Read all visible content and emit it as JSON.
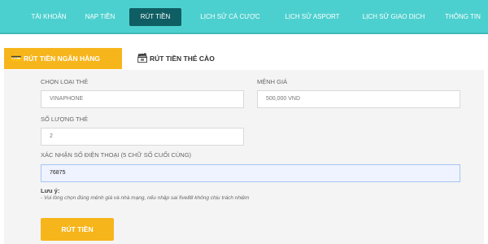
{
  "nav": {
    "items": [
      {
        "label": "TÀI KHOẢN"
      },
      {
        "label": "NẠP TIỀN"
      },
      {
        "label": "RÚT TIỀN"
      },
      {
        "label": "LỊCH SỬ CÁ CƯỢC"
      },
      {
        "label": "LỊCH SỬ ASPORT"
      },
      {
        "label": "LỊCH SỬ GIAO DỊCH"
      },
      {
        "label": "THÔNG TIN"
      }
    ],
    "active_index": 2
  },
  "tabs": [
    {
      "label": "RÚT TIỀN NGÂN HÀNG",
      "icon": "bank-withdraw-icon",
      "active": true
    },
    {
      "label": "RÚT TIỀN THẺ CÀO",
      "icon": "card-icon",
      "active": false
    }
  ],
  "form": {
    "card_type": {
      "label": "CHỌN LOẠI THẺ",
      "value": "VINAPHONE"
    },
    "denomination": {
      "label": "MỆNH GIÁ",
      "value": "500,000 VND"
    },
    "quantity": {
      "label": "SỐ LƯỢNG THẺ",
      "value": "2"
    },
    "phone_confirm": {
      "label": "XÁC NHẬN SỐ ĐIỆN THOẠI (5 CHỮ SỐ CUỐI CÙNG)",
      "value": "76875"
    }
  },
  "note": {
    "title": "Lưu ý:",
    "text": "- Vui lòng chọn đúng mệnh giá và nhà mạng, nếu nhập sai five88 không chịu trách nhiệm"
  },
  "submit_label": "RÚT TIỀN",
  "colors": {
    "nav_bg": "#4cd0cf",
    "nav_active": "#0f5e63",
    "accent": "#f7b51c"
  }
}
